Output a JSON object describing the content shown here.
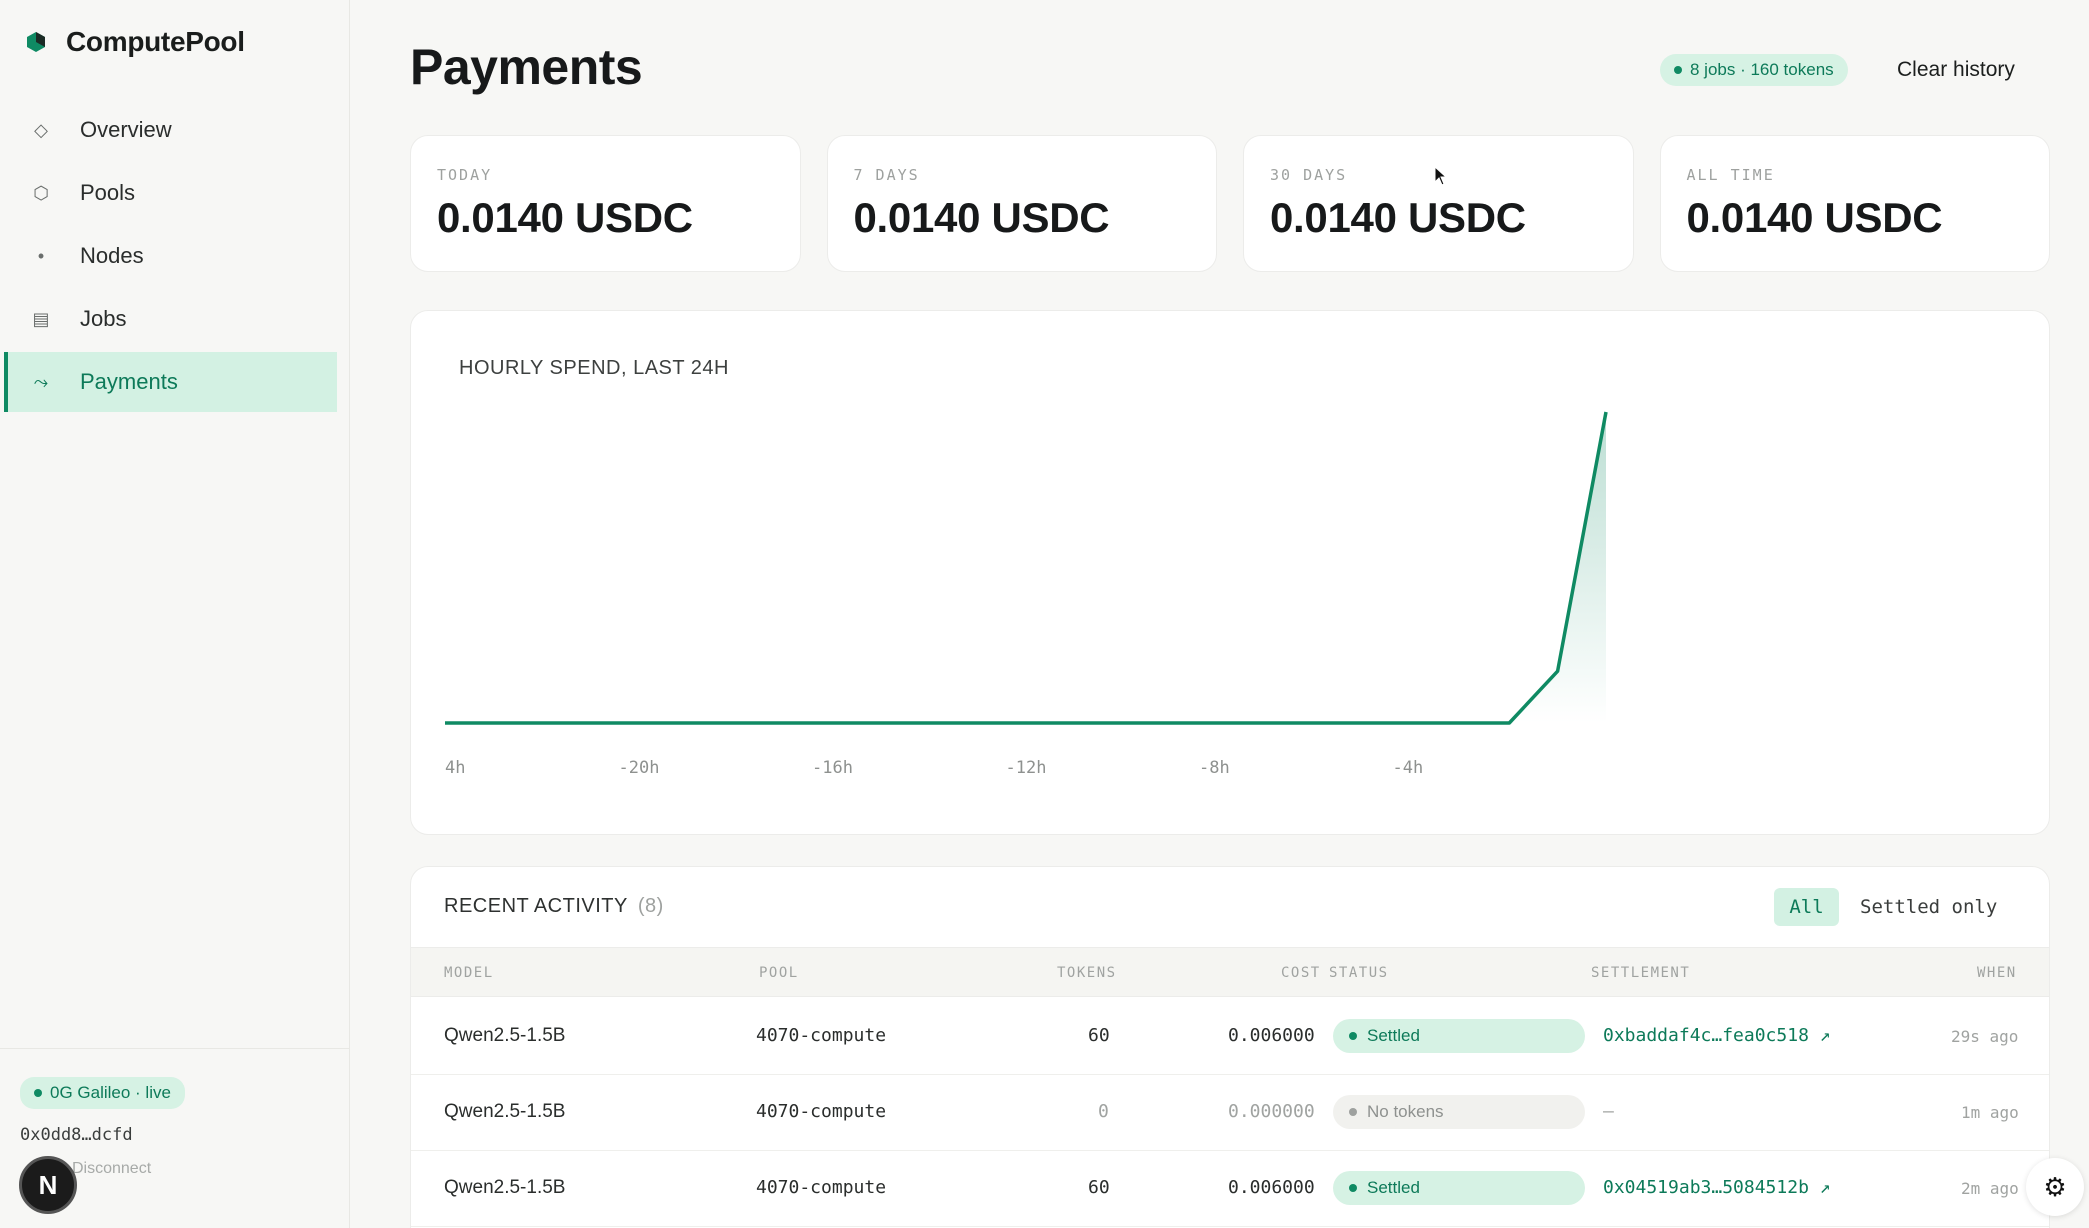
{
  "brand": {
    "name": "ComputePool",
    "accent": "#0f8a63"
  },
  "sidebar": {
    "items": [
      {
        "label": "Overview",
        "icon": "diamond-icon",
        "glyph": "◇"
      },
      {
        "label": "Pools",
        "icon": "hexagon-icon",
        "glyph": "⬡"
      },
      {
        "label": "Nodes",
        "icon": "dot-icon",
        "glyph": "•"
      },
      {
        "label": "Jobs",
        "icon": "list-icon",
        "glyph": "▤"
      },
      {
        "label": "Payments",
        "icon": "trend-arrow-icon",
        "glyph": "⤳",
        "active": true
      }
    ],
    "network_badge": "0G Galileo · live",
    "wallet": "0x0dd8…dcfd",
    "disconnect": "Disconnect"
  },
  "header": {
    "title": "Payments",
    "jobs_pill": "8 jobs · 160 tokens",
    "clear_history": "Clear history"
  },
  "stats": [
    {
      "label": "TODAY",
      "value": "0.0140 USDC"
    },
    {
      "label": "7 DAYS",
      "value": "0.0140 USDC"
    },
    {
      "label": "30 DAYS",
      "value": "0.0140 USDC"
    },
    {
      "label": "ALL TIME",
      "value": "0.0140 USDC"
    }
  ],
  "chart_data": {
    "type": "area",
    "title": "HOURLY SPEND, LAST 24H",
    "xlabel": "",
    "ylabel": "",
    "x_ticks": [
      "4h",
      "-20h",
      "-16h",
      "-12h",
      "-8h",
      "-4h"
    ],
    "x": [
      -24,
      -23,
      -22,
      -21,
      -20,
      -19,
      -18,
      -17,
      -16,
      -15,
      -14,
      -13,
      -12,
      -11,
      -10,
      -9,
      -8,
      -7,
      -6,
      -5,
      -4,
      -3,
      -2,
      -1,
      0
    ],
    "values": [
      0,
      0,
      0,
      0,
      0,
      0,
      0,
      0,
      0,
      0,
      0,
      0,
      0,
      0,
      0,
      0,
      0,
      0,
      0,
      0,
      0,
      0,
      0,
      0.002,
      0.012
    ],
    "xlim": [
      -24,
      0
    ],
    "ylim": [
      0,
      0.0125
    ],
    "color": "#0f8a63",
    "grid": false
  },
  "activity": {
    "title": "RECENT ACTIVITY",
    "count": "(8)",
    "filter_all": "All",
    "filter_settled": "Settled only",
    "columns": [
      "MODEL",
      "POOL",
      "TOKENS",
      "COST",
      "STATUS",
      "SETTLEMENT",
      "WHEN"
    ],
    "rows": [
      {
        "model": "Qwen2.5-1.5B",
        "pool": "4070-compute",
        "tokens": "60",
        "cost": "0.006000",
        "status": "Settled",
        "settlement": "0xbaddaf4c…fea0c518 ↗",
        "when": "29s ago"
      },
      {
        "model": "Qwen2.5-1.5B",
        "pool": "4070-compute",
        "tokens": "0",
        "cost": "0.000000",
        "status": "No tokens",
        "settlement": "—",
        "when": "1m ago"
      },
      {
        "model": "Qwen2.5-1.5B",
        "pool": "4070-compute",
        "tokens": "60",
        "cost": "0.006000",
        "status": "Settled",
        "settlement": "0x04519ab3…5084512b ↗",
        "when": "2m ago"
      }
    ]
  },
  "n_badge": "N",
  "settings_icon": "⚙"
}
